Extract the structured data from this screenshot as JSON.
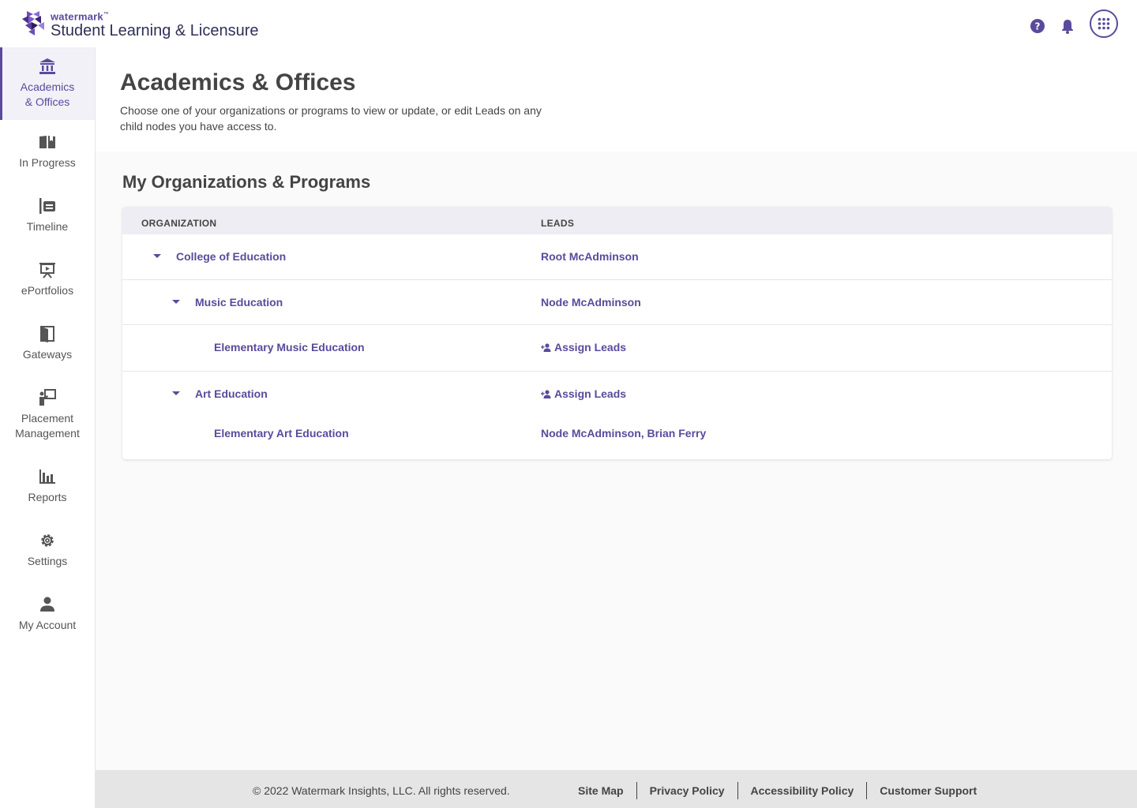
{
  "header": {
    "brand": "watermark",
    "brand_tm": "™",
    "product": "Student Learning & Licensure",
    "icons": [
      "help-icon",
      "bell-icon",
      "apps-grid-icon"
    ]
  },
  "sidebar": {
    "items": [
      {
        "label_line1": "Academics",
        "label_line2": "& Offices",
        "icon": "institution-icon",
        "active": true
      },
      {
        "label": "In Progress",
        "icon": "open-book-icon"
      },
      {
        "label": "Timeline",
        "icon": "timeline-icon"
      },
      {
        "label": "ePortfolios",
        "icon": "presentation-board-icon"
      },
      {
        "label": "Gateways",
        "icon": "door-icon"
      },
      {
        "label_line1": "Placement",
        "label_line2": "Management",
        "icon": "teacher-board-icon"
      },
      {
        "label": "Reports",
        "icon": "bar-chart-icon"
      },
      {
        "label": "Settings",
        "icon": "gear-icon"
      },
      {
        "label": "My Account",
        "icon": "person-icon"
      }
    ]
  },
  "page": {
    "title": "Academics & Offices",
    "description": "Choose one of your organizations or programs to view or update, or edit Leads on any child nodes you have access to."
  },
  "section": {
    "title": "My Organizations & Programs"
  },
  "table": {
    "headers": {
      "organization": "ORGANIZATION",
      "leads": "LEADS"
    },
    "rows": [
      {
        "organization": "College of Education",
        "leads": "Root McAdminson",
        "level": 0,
        "expandable": true
      },
      {
        "organization": "Music Education",
        "leads": "Node McAdminson",
        "level": 1,
        "expandable": true
      },
      {
        "organization": "Elementary Music Education",
        "leads": "Assign Leads",
        "level": 2,
        "expandable": false,
        "assign": true
      },
      {
        "organization": "Art Education",
        "leads": "Assign Leads",
        "level": 1,
        "expandable": true,
        "assign": true
      },
      {
        "organization": "Elementary Art Education",
        "leads": "Node McAdminson, Brian Ferry",
        "level": 2,
        "expandable": false
      }
    ]
  },
  "footer": {
    "copyright": "© 2022 Watermark Insights, LLC. All rights reserved.",
    "links": [
      "Site Map",
      "Privacy Policy",
      "Accessibility Policy",
      "Customer Support"
    ]
  },
  "colors": {
    "accent": "#5a4a9c",
    "text": "#444444",
    "footer_bg": "#e5e5e5"
  }
}
